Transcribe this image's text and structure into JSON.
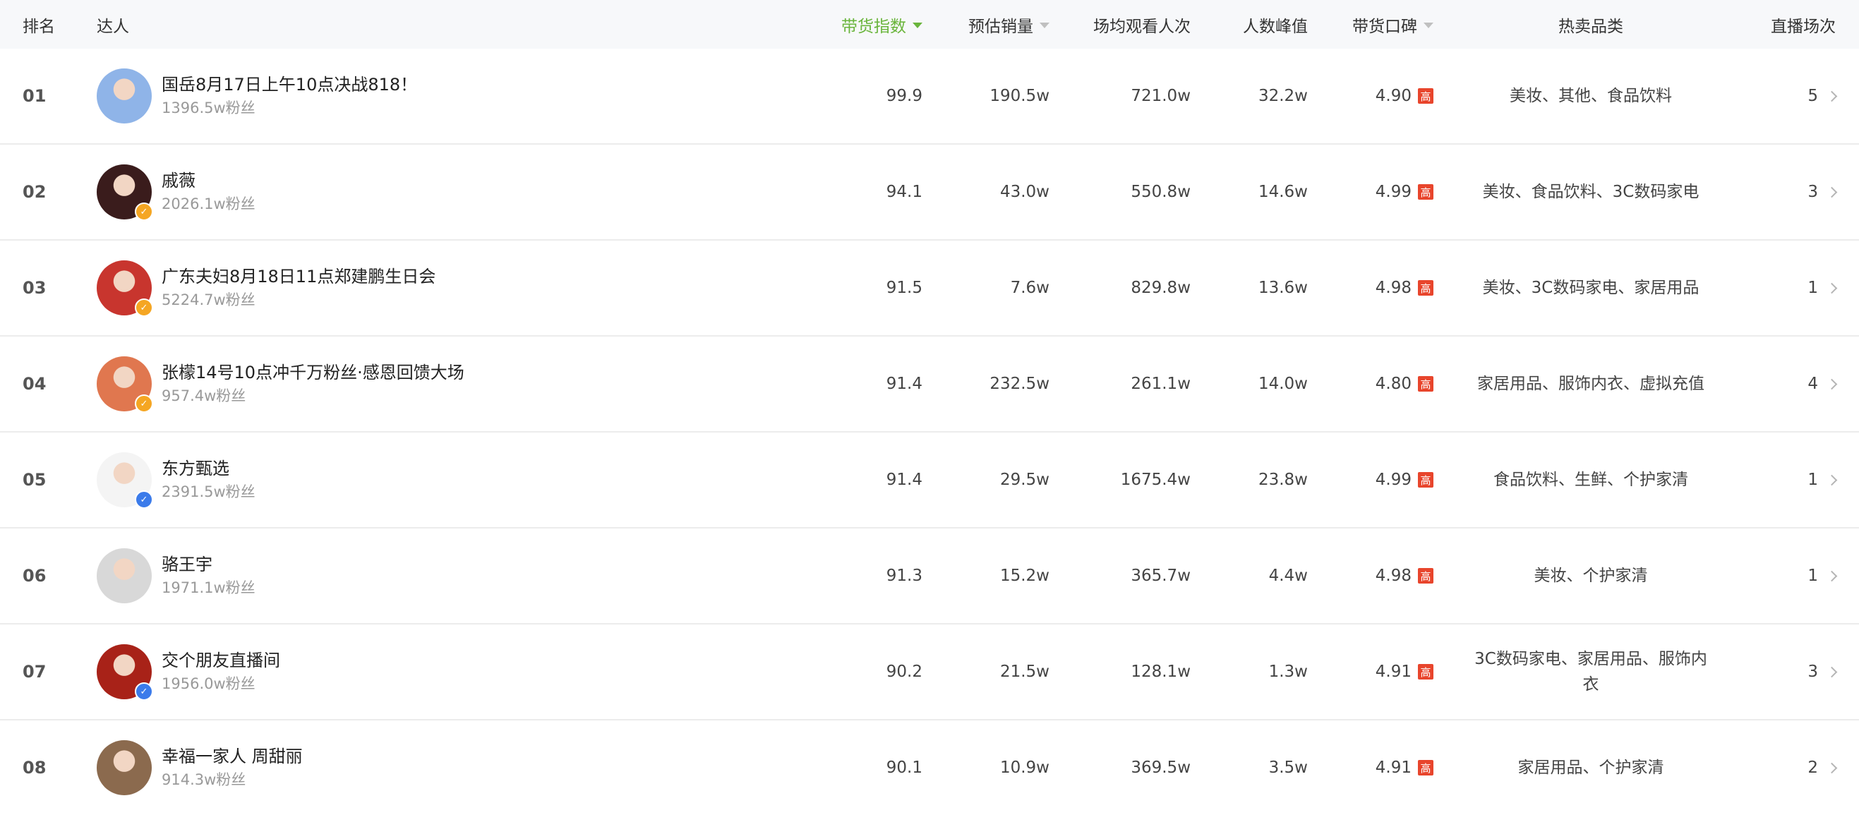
{
  "headers": {
    "rank": "排名",
    "talent": "达人",
    "sales_index": "带货指数",
    "est_sales": "预估销量",
    "avg_views": "场均观看人次",
    "peak": "人数峰值",
    "reputation": "带货口碑",
    "categories": "热卖品类",
    "live_count": "直播场次"
  },
  "colors": {
    "active": "#6ab53c",
    "tag_high": "#e8452c",
    "badge_orange": "#f5a623",
    "badge_blue": "#3b7bea"
  },
  "tag_high_label": "高",
  "rows": [
    {
      "rank": "01",
      "name": "国岳8月17日上午10点决战818！",
      "fans": "1396.5w粉丝",
      "sales_index": "99.9",
      "est_sales": "190.5w",
      "avg_views": "721.0w",
      "peak": "32.2w",
      "reputation": "4.90",
      "categories": "美妆、其他、食品饮料",
      "live_count": "5",
      "badge": "none",
      "avatar_color": "#8fb4e8"
    },
    {
      "rank": "02",
      "name": "戚薇",
      "fans": "2026.1w粉丝",
      "sales_index": "94.1",
      "est_sales": "43.0w",
      "avg_views": "550.8w",
      "peak": "14.6w",
      "reputation": "4.99",
      "categories": "美妆、食品饮料、3C数码家电",
      "live_count": "3",
      "badge": "orange",
      "avatar_color": "#3a1c1c"
    },
    {
      "rank": "03",
      "name": "广东夫妇8月18日11点郑建鹏生日会",
      "fans": "5224.7w粉丝",
      "sales_index": "91.5",
      "est_sales": "7.6w",
      "avg_views": "829.8w",
      "peak": "13.6w",
      "reputation": "4.98",
      "categories": "美妆、3C数码家电、家居用品",
      "live_count": "1",
      "badge": "orange",
      "avatar_color": "#c8352e"
    },
    {
      "rank": "04",
      "name": "张檬14号10点冲千万粉丝·感恩回馈大场",
      "fans": "957.4w粉丝",
      "sales_index": "91.4",
      "est_sales": "232.5w",
      "avg_views": "261.1w",
      "peak": "14.0w",
      "reputation": "4.80",
      "categories": "家居用品、服饰内衣、虚拟充值",
      "live_count": "4",
      "badge": "orange",
      "avatar_color": "#e0774f"
    },
    {
      "rank": "05",
      "name": "东方甄选",
      "fans": "2391.5w粉丝",
      "sales_index": "91.4",
      "est_sales": "29.5w",
      "avg_views": "1675.4w",
      "peak": "23.8w",
      "reputation": "4.99",
      "categories": "食品饮料、生鲜、个护家清",
      "live_count": "1",
      "badge": "blue",
      "avatar_color": "#f4f4f4"
    },
    {
      "rank": "06",
      "name": "骆王宇",
      "fans": "1971.1w粉丝",
      "sales_index": "91.3",
      "est_sales": "15.2w",
      "avg_views": "365.7w",
      "peak": "4.4w",
      "reputation": "4.98",
      "categories": "美妆、个护家清",
      "live_count": "1",
      "badge": "none",
      "avatar_color": "#d8d8d8"
    },
    {
      "rank": "07",
      "name": "交个朋友直播间",
      "fans": "1956.0w粉丝",
      "sales_index": "90.2",
      "est_sales": "21.5w",
      "avg_views": "128.1w",
      "peak": "1.3w",
      "reputation": "4.91",
      "categories": "3C数码家电、家居用品、服饰内衣",
      "live_count": "3",
      "badge": "blue",
      "avatar_color": "#a82218"
    },
    {
      "rank": "08",
      "name": "幸福一家人 周甜丽",
      "fans": "914.3w粉丝",
      "sales_index": "90.1",
      "est_sales": "10.9w",
      "avg_views": "369.5w",
      "peak": "3.5w",
      "reputation": "4.91",
      "categories": "家居用品、个护家清",
      "live_count": "2",
      "badge": "none",
      "avatar_color": "#8b6a4e"
    }
  ]
}
